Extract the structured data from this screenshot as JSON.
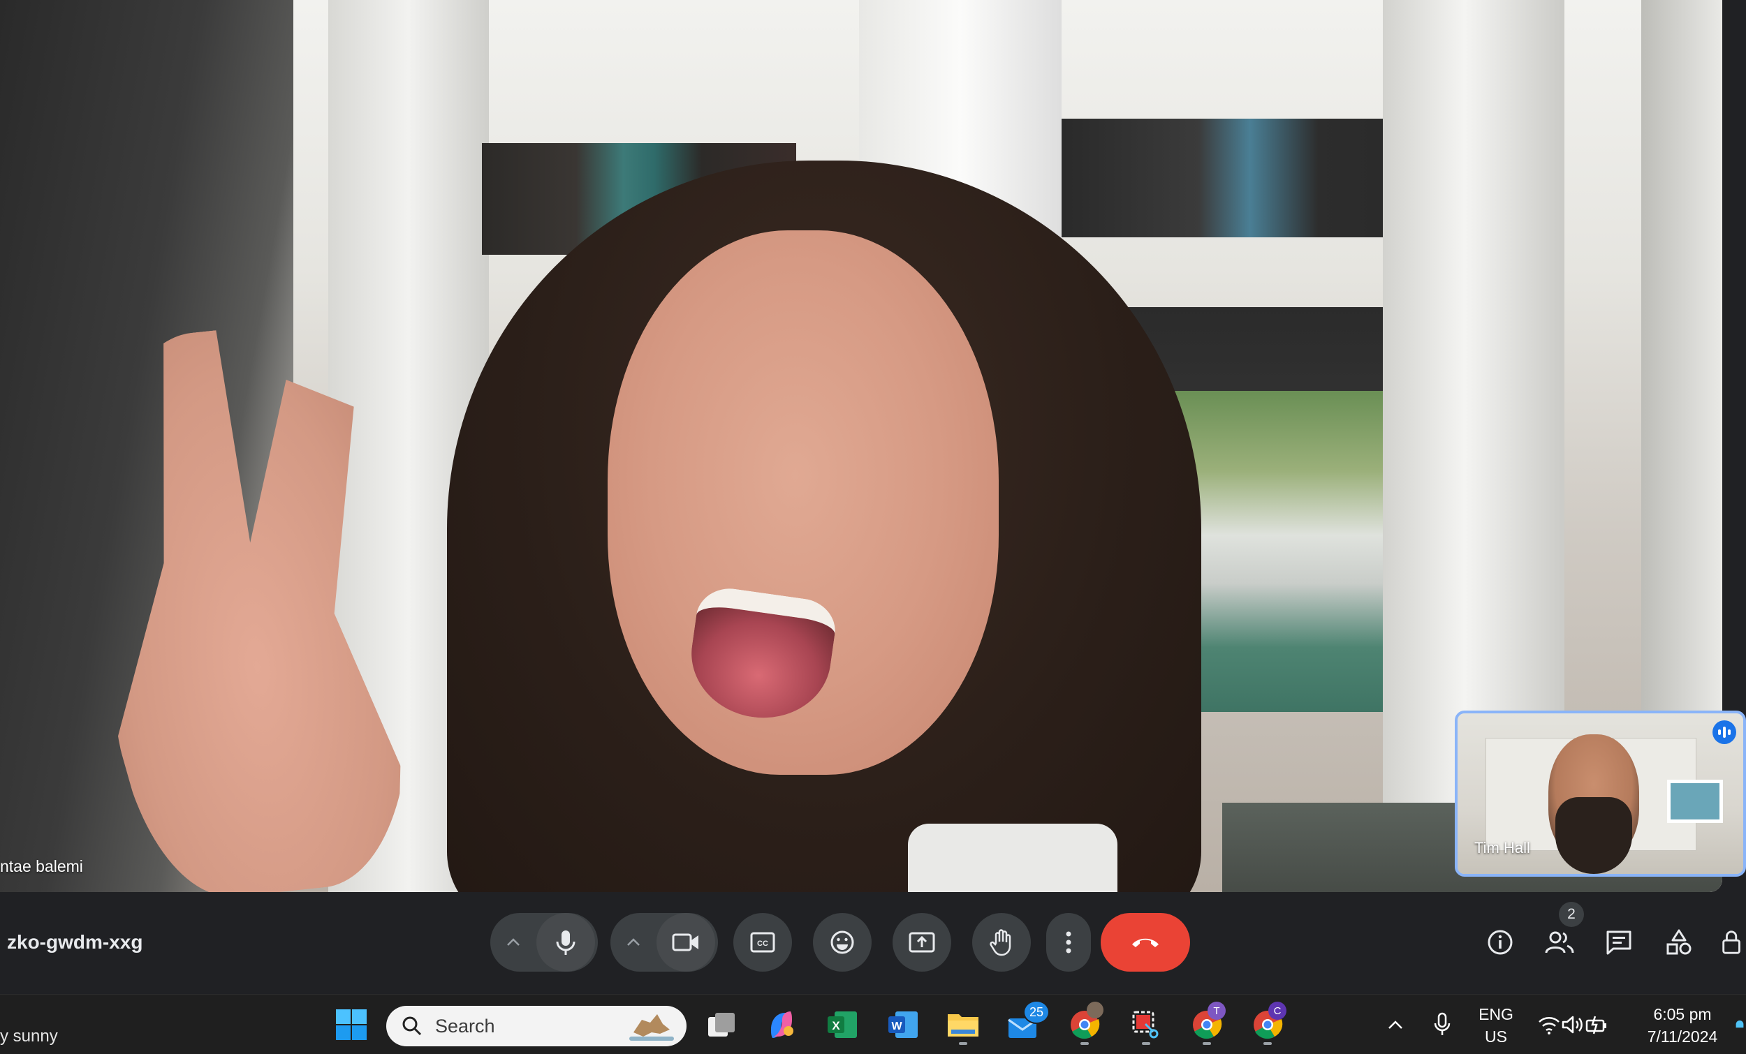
{
  "main_video": {
    "participant_name": "ntae balemi"
  },
  "self_view": {
    "participant_name": "Tim Hall",
    "speaking_indicator": "audio-wave-icon"
  },
  "control_bar": {
    "meeting_code": "zko-gwdm-xxg",
    "buttons": [
      "mic-options-caret",
      "microphone",
      "camera-options-caret",
      "camera",
      "captions",
      "reactions",
      "present-screen",
      "raise-hand",
      "more-options",
      "leave-call"
    ],
    "people_count": "2",
    "right_icons": [
      "meeting-info-icon",
      "people-icon",
      "chat-icon",
      "activities-icon",
      "host-controls-icon"
    ],
    "colors": {
      "leave": "#ea4335",
      "button": "#3c4043",
      "self_border": "#8ab4f8",
      "speaking": "#1a73e8"
    }
  },
  "taskbar": {
    "weather_text": "y sunny",
    "search_placeholder": "Search",
    "mail_badge": "25",
    "chrome_profile_1": "T",
    "chrome_profile_2": "C",
    "language_line1": "ENG",
    "language_line2": "US",
    "time": "6:05 pm",
    "date": "7/11/2024"
  }
}
